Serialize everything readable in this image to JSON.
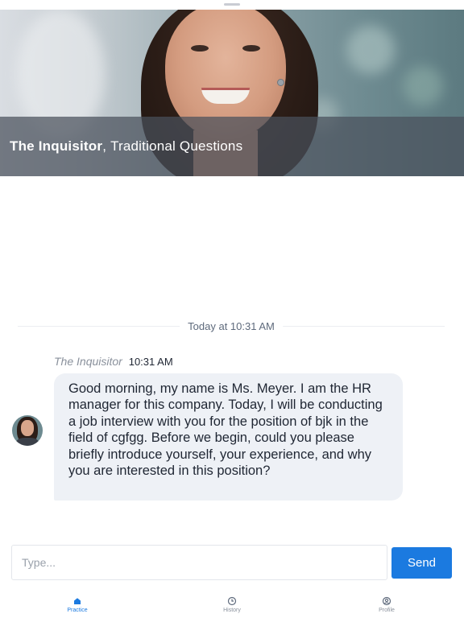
{
  "header": {
    "name": "The Inquisitor",
    "separator": ",",
    "subtitle": "Traditional Questions"
  },
  "chat": {
    "date_divider": "Today at 10:31 AM",
    "messages": [
      {
        "sender": "The Inquisitor",
        "time": "10:31 AM",
        "text": "Good morning, my name is Ms. Meyer. I am the HR manager for this company. Today, I will be conducting a job interview with you for the position of bjk in the field of cgfgg. Before we begin, could you please briefly introduce yourself, your experience, and why you are interested in this position?"
      }
    ]
  },
  "composer": {
    "placeholder": "Type...",
    "value": "",
    "send_label": "Send"
  },
  "tabbar": {
    "items": [
      {
        "label": "Practice",
        "icon": "home-icon",
        "active": true
      },
      {
        "label": "History",
        "icon": "clock-icon",
        "active": false
      },
      {
        "label": "Profile",
        "icon": "profile-icon",
        "active": false
      }
    ]
  },
  "colors": {
    "accent": "#1b7ae0",
    "bubble": "#eef1f6",
    "caption_overlay": "#4a505c"
  }
}
